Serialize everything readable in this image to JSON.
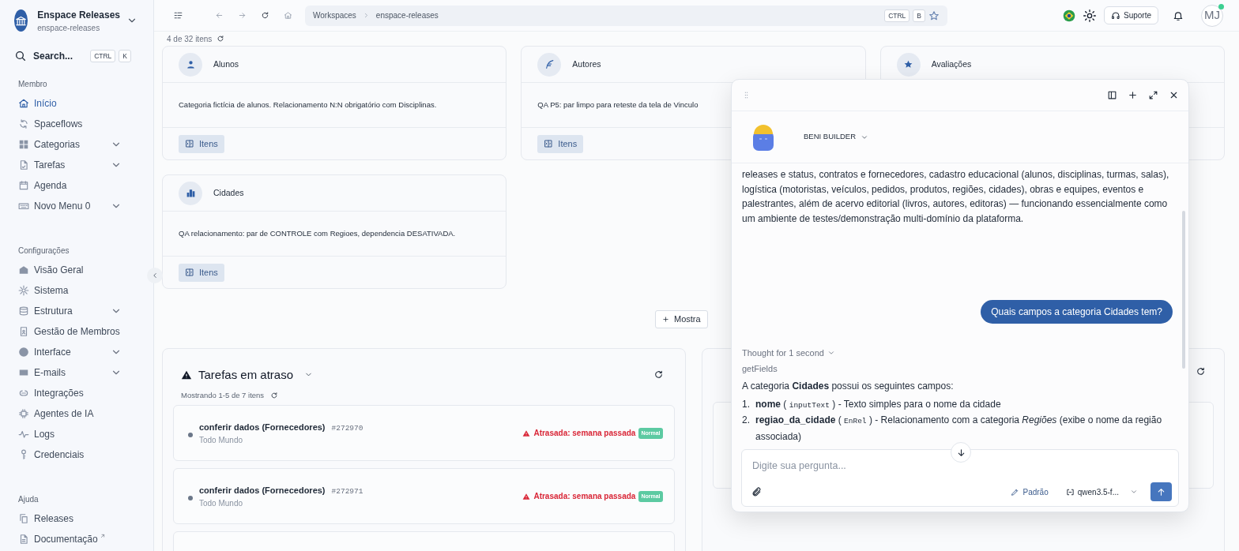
{
  "workspace": {
    "name": "Enspace Releases",
    "slug": "enspace-releases"
  },
  "search": {
    "label": "Search...",
    "keys": [
      "CTRL",
      "K"
    ]
  },
  "sidebar": {
    "sections": [
      {
        "title": "Membro",
        "items": [
          {
            "label": "Início",
            "kind": "link",
            "selected": true
          },
          {
            "label": "Spaceflows",
            "kind": "link",
            "selected": false
          },
          {
            "label": "Categorias",
            "kind": "group",
            "selected": false,
            "expanded": false
          },
          {
            "label": "Tarefas",
            "kind": "group",
            "selected": false,
            "expanded": false
          },
          {
            "label": "Agenda",
            "kind": "link",
            "selected": false
          },
          {
            "label": "Novo Menu 0",
            "kind": "group",
            "selected": false,
            "expanded": false
          }
        ]
      },
      {
        "title": "Configurações",
        "items": [
          {
            "label": "Visão Geral",
            "kind": "link",
            "selected": false
          },
          {
            "label": "Sistema",
            "kind": "link",
            "selected": false
          },
          {
            "label": "Estrutura",
            "kind": "group",
            "selected": false,
            "expanded": false
          },
          {
            "label": "Gestão de Membros",
            "kind": "link",
            "selected": false
          },
          {
            "label": "Interface",
            "kind": "group",
            "selected": false,
            "expanded": false
          },
          {
            "label": "E-mails",
            "kind": "group",
            "selected": false,
            "expanded": false
          },
          {
            "label": "Integrações",
            "kind": "link",
            "selected": false
          },
          {
            "label": "Agentes de IA",
            "kind": "link",
            "selected": false
          },
          {
            "label": "Logs",
            "kind": "link",
            "selected": false
          },
          {
            "label": "Credenciais",
            "kind": "link",
            "selected": false
          }
        ]
      },
      {
        "title": "Ajuda",
        "items": [
          {
            "label": "Releases",
            "kind": "link",
            "selected": false
          },
          {
            "label": "Documentação",
            "kind": "external",
            "selected": false
          }
        ]
      }
    ]
  },
  "topbar": {
    "breadcrumb": [
      "Workspaces",
      "enspace-releases"
    ],
    "shortcut": [
      "CTRL",
      "B"
    ],
    "support": "Suporte",
    "avatar": "MJ",
    "online": true
  },
  "list_count": "4 de 32 itens",
  "categories": [
    {
      "title": "Alunos",
      "description": "Categoria fictícia de alunos. Relacionamento N:N obrigatório com Disciplinas.",
      "button": "Itens"
    },
    {
      "title": "Autores",
      "description": "QA P5: par limpo para reteste da tela de Vinculo",
      "button": "Itens"
    },
    {
      "title": "Avaliações"
    },
    {
      "title": "Cidades",
      "description": "QA relacionamento: par de CONTROLE com Regioes, dependencia DESATIVADA.",
      "button": "Itens"
    }
  ],
  "show_more": "Mostra",
  "overdue": {
    "title": "Tarefas em atraso",
    "count": "Mostrando 1-5 de 7 itens",
    "tasks": [
      {
        "title": "conferir dados (Fornecedores)",
        "id": "#272970",
        "assignee": "Todo Mundo",
        "due": "Atrasada: semana passada",
        "priority": "Normal"
      },
      {
        "title": "conferir dados (Fornecedores)",
        "id": "#272971",
        "assignee": "Todo Mundo",
        "due": "Atrasada: semana passada",
        "priority": "Normal"
      }
    ]
  },
  "chat": {
    "agent": "BENI BUILDER",
    "intro": "releases e status, contratos e fornecedores, cadastro educacional (alunos, disciplinas, turmas, salas), logística (motoristas, veículos, pedidos, produtos, regiões, cidades), obras e equipes, eventos e palestrantes, além de acervo editorial (livros, autores, editoras) — funcionando essencialmente como um ambiente de testes/demonstração multi-domínio da plataforma.",
    "user_message": "Quais campos a categoria Cidades tem?",
    "thought": "Thought for 1 second",
    "tool": "getFields",
    "answer": "A categoria **Cidades** possui os seguintes campos:",
    "fields": [
      {
        "number": "1.",
        "parts": [
          {
            "kind": "bold",
            "text": "nome"
          },
          {
            "kind": "plain",
            "text": " ( "
          },
          {
            "kind": "code",
            "text": "inputText"
          },
          {
            "kind": "plain",
            "text": " ) - Texto simples para o nome da cidade"
          }
        ]
      },
      {
        "number": "2.",
        "parts": [
          {
            "kind": "bold",
            "text": "regiao_da_cidade"
          },
          {
            "kind": "plain",
            "text": " ( "
          },
          {
            "kind": "code",
            "text": "EnRel"
          },
          {
            "kind": "plain",
            "text": " ) - Relacionamento com a categoria *Regiões* (exibe o nome da região associada)"
          }
        ]
      }
    ],
    "placeholder": "Digite sua pergunta...",
    "mode": "Padrão",
    "model": "qwen3.5-f..."
  }
}
